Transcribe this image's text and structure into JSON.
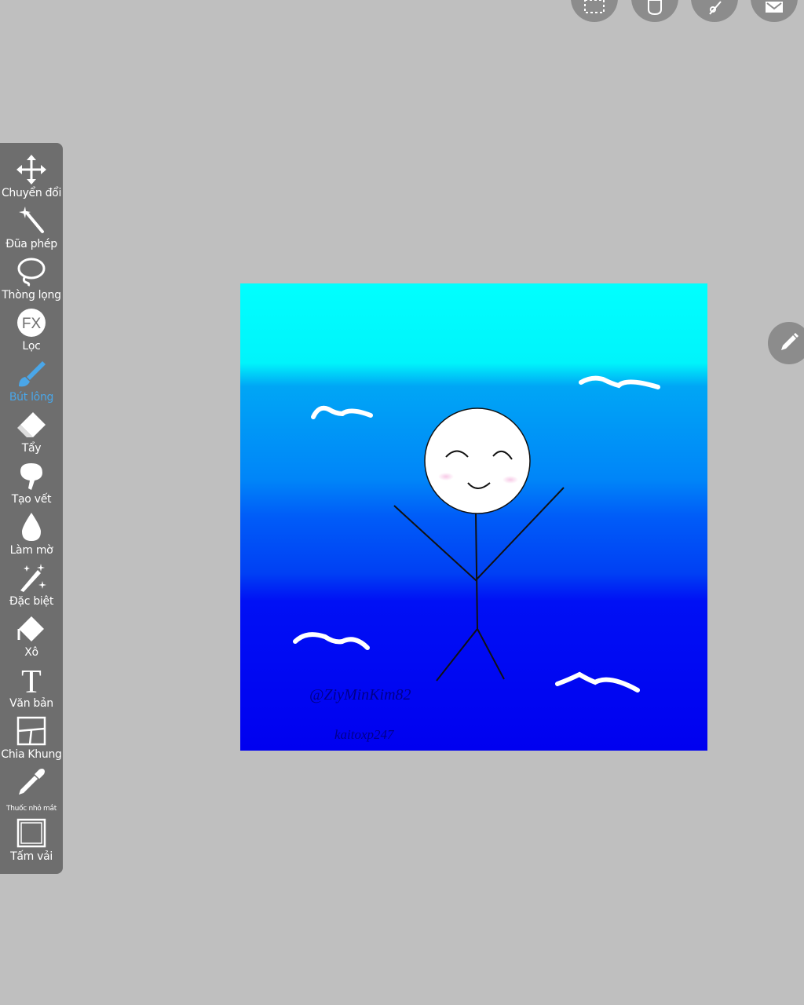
{
  "toolbar": {
    "tools": [
      {
        "label": "Chuyển đổi",
        "icon": "move-icon"
      },
      {
        "label": "Đũa phép",
        "icon": "magic-wand-icon"
      },
      {
        "label": "Thòng lọng",
        "icon": "lasso-icon"
      },
      {
        "label": "Lọc",
        "icon": "fx-filter-icon",
        "glyph": "FX"
      },
      {
        "label": "Bút lông",
        "icon": "brush-icon",
        "active": true
      },
      {
        "label": "Tẩy",
        "icon": "eraser-icon"
      },
      {
        "label": "Tạo vết",
        "icon": "smudge-icon"
      },
      {
        "label": "Làm mờ",
        "icon": "blur-drop-icon"
      },
      {
        "label": "Đặc biệt",
        "icon": "special-brush-icon"
      },
      {
        "label": "Xô",
        "icon": "bucket-icon"
      },
      {
        "label": "Văn bản",
        "icon": "text-icon",
        "glyph": "T"
      },
      {
        "label": "Chia Khung",
        "icon": "frame-divider-icon"
      },
      {
        "label": "Thuốc nhỏ mắt",
        "icon": "eyedropper-icon"
      },
      {
        "label": "Tấm vải",
        "icon": "canvas-icon"
      }
    ]
  },
  "top_buttons": [
    "selection-icon",
    "shape-icon",
    "ruler-icon",
    "layers-icon"
  ],
  "right_button": "pencil-icon",
  "artwork": {
    "signature_1": "@ZiyMinKim82",
    "signature_2": "kaitoxp247",
    "colors": {
      "top": "#00ffff",
      "mid": "#0080ff",
      "bottom": "#0000ff",
      "accent": "#4aa6e8"
    }
  }
}
